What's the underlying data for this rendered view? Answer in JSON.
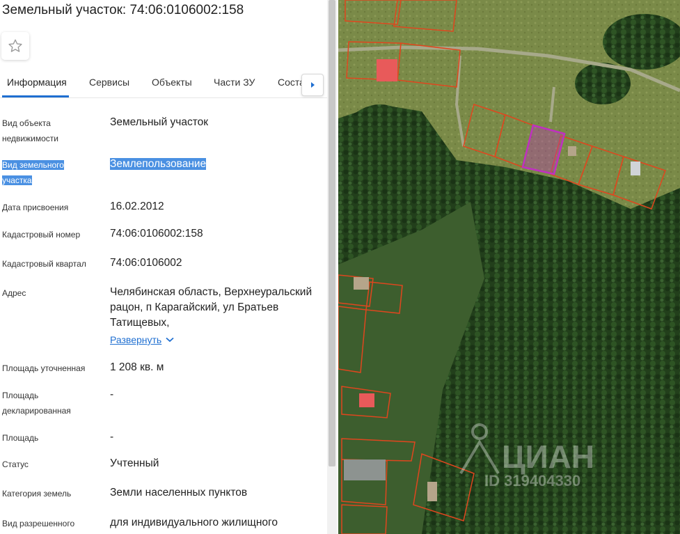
{
  "header": {
    "title": "Земельный участок: 74:06:0106002:158"
  },
  "tabs": [
    {
      "label": "Информация",
      "active": true
    },
    {
      "label": "Сервисы"
    },
    {
      "label": "Объекты"
    },
    {
      "label": "Части ЗУ"
    },
    {
      "label": "Соста"
    }
  ],
  "rows": [
    {
      "label": "Вид объекта недвижимости",
      "value": "Земельный участок"
    },
    {
      "label": "Вид земельного участка",
      "value": "Землепользование",
      "highlighted": true
    },
    {
      "label": "Дата присвоения",
      "value": "16.02.2012"
    },
    {
      "label": "Кадастровый номер",
      "value": "74:06:0106002:158"
    },
    {
      "label": "Кадастровый квартал",
      "value": "74:06:0106002"
    },
    {
      "label": "Адрес",
      "value": "Челябинская область, Верхнеуральский рацон, п Карагайский, ул Братьев Татищевых,",
      "expand_label": "Развернуть"
    },
    {
      "label": "Площадь уточненная",
      "value": "1 208 кв. м"
    },
    {
      "label": "Площадь декларированная",
      "value": "-"
    },
    {
      "label": "Площадь",
      "value": "-"
    },
    {
      "label": "Статус",
      "value": "Учтенный"
    },
    {
      "label": "Категория земель",
      "value": "Земли населенных пунктов"
    },
    {
      "label": "Вид разрешенного",
      "value": "для индивидуального жилищного"
    }
  ],
  "map": {
    "watermark_brand": "ЦИАН",
    "watermark_id": "ID 319404330",
    "colors": {
      "parcel": "#e0461e",
      "selected_parcel": "#c030c0",
      "forest": "#1f3a18",
      "field": "#7d8a4a"
    }
  }
}
